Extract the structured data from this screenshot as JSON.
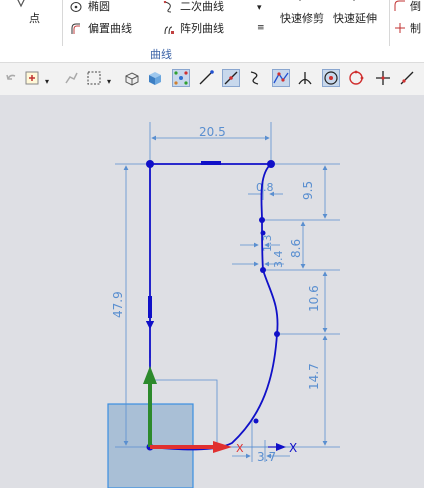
{
  "ribbon": {
    "point_label": "点",
    "ellipse_label": "椭圆",
    "offset_curve_label": "偏置曲线",
    "conic_label": "二次曲线",
    "pattern_curve_label": "阵列曲线",
    "quick_trim_label": "快速修剪",
    "quick_extend_label": "快速延伸",
    "chamfer_label_partial": "倒",
    "make_corner_label_partial": "制",
    "group_label": "曲线"
  },
  "toolbar": {
    "buttons": [
      {
        "icon": "undo-icon",
        "active": false
      },
      {
        "icon": "snap-point-icon",
        "active": false
      },
      {
        "icon": "constraint-icon",
        "active": false
      },
      {
        "icon": "box-select-icon",
        "active": false
      },
      {
        "icon": "wireframe-view-icon",
        "active": false
      },
      {
        "icon": "shaded-view-icon",
        "active": false
      },
      {
        "icon": "control-points-icon",
        "active": true
      },
      {
        "icon": "line-end-icon",
        "active": false
      },
      {
        "icon": "line-midpoint-icon",
        "active": true
      },
      {
        "icon": "curve-point-icon",
        "active": false
      },
      {
        "icon": "spline-point-icon",
        "active": true
      },
      {
        "icon": "tangent-icon",
        "active": false
      },
      {
        "icon": "center-point-icon",
        "active": true
      },
      {
        "icon": "quadrant-point-icon",
        "active": false
      },
      {
        "icon": "intersection-icon",
        "active": false
      },
      {
        "icon": "point-on-curve-icon",
        "active": false
      }
    ]
  },
  "sketch": {
    "dimensions": {
      "top_width": "20.5",
      "overall_height": "47.9",
      "seg1_height": "9.5",
      "seg2_height": "8.6",
      "seg3_height": "10.6",
      "seg4_height": "14.7",
      "offset_top": "0.8",
      "offset_mid1": "1.3",
      "offset_mid2": "3.4",
      "bottom_offset": "3.7"
    },
    "axis_x_label": "X",
    "triad_x_label": "X",
    "colors": {
      "curve": "#1010c8",
      "dimension": "#5a8fd0",
      "y_axis": "#2c8a2c",
      "x_axis": "#e03030",
      "datum_plane": "#6fa8dc"
    }
  }
}
